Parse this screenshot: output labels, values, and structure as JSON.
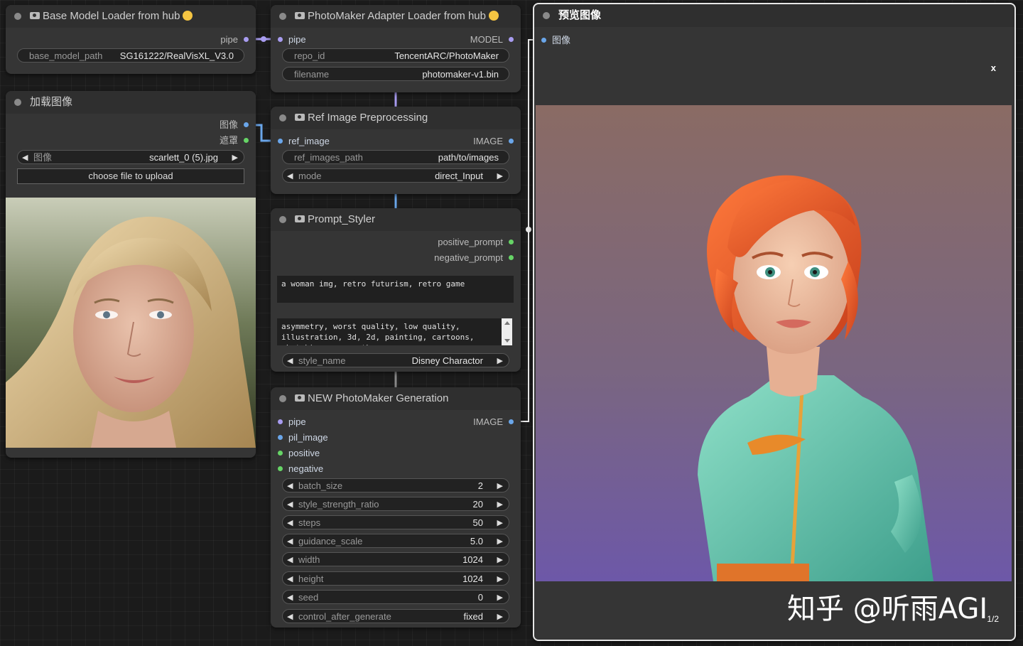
{
  "nodes": {
    "base_model": {
      "title": "Base Model Loader from hub",
      "output": "pipe",
      "widget_label": "base_model_path",
      "widget_value": "SG161222/RealVisXL_V3.0"
    },
    "load_image": {
      "title": "加载图像",
      "outputs": [
        "图像",
        "遮罩"
      ],
      "image_label": "图像",
      "image_value": "scarlett_0 (5).jpg",
      "upload_label": "choose file to upload"
    },
    "photomaker_adapter": {
      "title": "PhotoMaker Adapter Loader from hub",
      "input": "pipe",
      "output": "MODEL",
      "widgets": [
        {
          "label": "repo_id",
          "value": "TencentARC/PhotoMaker"
        },
        {
          "label": "filename",
          "value": "photomaker-v1.bin"
        }
      ]
    },
    "ref_preprocess": {
      "title": "Ref Image Preprocessing",
      "input": "ref_image",
      "output": "IMAGE",
      "widgets": [
        {
          "label": "ref_images_path",
          "value": "path/to/images"
        },
        {
          "label": "mode",
          "value": "direct_Input"
        }
      ]
    },
    "prompt_styler": {
      "title": "Prompt_Styler",
      "outputs": [
        "positive_prompt",
        "negative_prompt"
      ],
      "positive_text": "a woman img, retro futurism, retro game",
      "negative_text": "asymmetry, worst quality, low quality,\nillustration, 3d, 2d, painting, cartoons,\nsketch), open mouth",
      "style_label": "style_name",
      "style_value": "Disney Charactor"
    },
    "generation": {
      "title": "NEW PhotoMaker Generation",
      "inputs": [
        "pipe",
        "pil_image",
        "positive",
        "negative"
      ],
      "output": "IMAGE",
      "widgets": [
        {
          "label": "batch_size",
          "value": "2"
        },
        {
          "label": "style_strength_ratio",
          "value": "20"
        },
        {
          "label": "steps",
          "value": "50"
        },
        {
          "label": "guidance_scale",
          "value": "5.0"
        },
        {
          "label": "width",
          "value": "1024"
        },
        {
          "label": "height",
          "value": "1024"
        },
        {
          "label": "seed",
          "value": "0"
        },
        {
          "label": "control_after_generate",
          "value": "fixed"
        }
      ]
    },
    "preview": {
      "title": "预览图像",
      "input": "图像",
      "close": "x",
      "page": "1/2",
      "watermark": "知乎 @听雨AGI"
    }
  },
  "colors": {
    "socket_blue": "#6aa6ea",
    "socket_lavender": "#a89cf0",
    "socket_green": "#66d466",
    "node_bg": "#353535",
    "canvas_bg": "#1b1b1b"
  }
}
